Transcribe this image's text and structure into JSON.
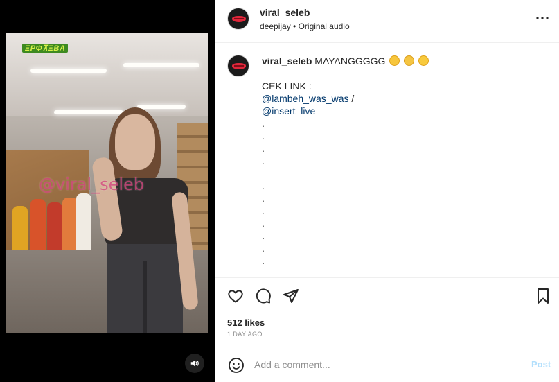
{
  "media": {
    "broadcast_logo_text": "ΞΡΦ⊼ΞΒΑ",
    "watermark_text": "@viral_seleb",
    "mute_icon": "speaker-icon"
  },
  "header": {
    "username": "viral_seleb",
    "audio_user": "deepijay",
    "separator": "•",
    "audio_label": "Original audio",
    "more_icon": "more-horizontal-icon"
  },
  "caption": {
    "username": "viral_seleb",
    "text": "MAYANGGGGG",
    "emojis": [
      "laughing-emoji",
      "thinking-emoji",
      "grinning-emoji"
    ],
    "lines": [
      {
        "type": "text",
        "value": "CEK LINK :"
      },
      {
        "type": "link",
        "value": "@lambeh_was_was",
        "suffix": " /"
      },
      {
        "type": "link",
        "value": "@insert_live",
        "suffix": ""
      },
      {
        "type": "text",
        "value": "."
      },
      {
        "type": "text",
        "value": "."
      },
      {
        "type": "text",
        "value": "."
      },
      {
        "type": "text",
        "value": "."
      },
      {
        "type": "text",
        "value": ""
      },
      {
        "type": "text",
        "value": "."
      },
      {
        "type": "text",
        "value": "."
      },
      {
        "type": "text",
        "value": "."
      },
      {
        "type": "text",
        "value": "."
      },
      {
        "type": "text",
        "value": "."
      },
      {
        "type": "text",
        "value": "."
      },
      {
        "type": "text",
        "value": "."
      }
    ]
  },
  "actions": {
    "like_icon": "heart-icon",
    "comment_icon": "comment-icon",
    "share_icon": "send-icon",
    "save_icon": "bookmark-icon",
    "likes_text": "512 likes",
    "time_ago": "1 DAY AGO"
  },
  "comment": {
    "emoji_icon": "smiley-icon",
    "placeholder": "Add a comment...",
    "post_label": "Post"
  },
  "colors": {
    "link": "#00376b",
    "post_disabled": "#b2dffc",
    "muted": "#8e8e8e"
  }
}
